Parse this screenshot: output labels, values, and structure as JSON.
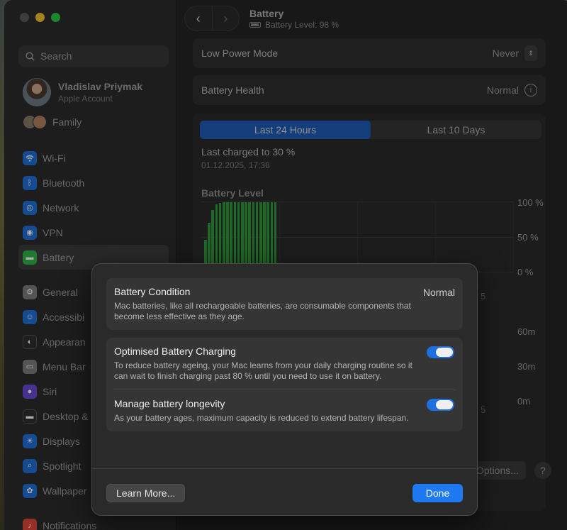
{
  "sidebar": {
    "search_placeholder": "Search",
    "user": {
      "name": "Vladislav Priymak",
      "subtitle": "Apple Account"
    },
    "family_label": "Family",
    "items": [
      {
        "label": "Wi-Fi",
        "icon": "wifi-icon"
      },
      {
        "label": "Bluetooth",
        "icon": "bluetooth-icon"
      },
      {
        "label": "Network",
        "icon": "network-icon"
      },
      {
        "label": "VPN",
        "icon": "vpn-icon"
      },
      {
        "label": "Battery",
        "icon": "battery-icon",
        "selected": true
      },
      {
        "label": "General",
        "icon": "gear-icon"
      },
      {
        "label": "Accessibi",
        "icon": "accessibility-icon"
      },
      {
        "label": "Appearan",
        "icon": "appearance-icon"
      },
      {
        "label": "Menu Bar",
        "icon": "menubar-icon"
      },
      {
        "label": "Siri",
        "icon": "siri-icon"
      },
      {
        "label": "Desktop &",
        "icon": "desktop-icon"
      },
      {
        "label": "Displays",
        "icon": "displays-icon"
      },
      {
        "label": "Spotlight",
        "icon": "spotlight-icon"
      },
      {
        "label": "Wallpaper",
        "icon": "wallpaper-icon"
      },
      {
        "label": "Notifications",
        "icon": "notifications-icon"
      }
    ]
  },
  "header": {
    "title": "Battery",
    "subtitle": "Battery Level: 98 %",
    "back": "‹",
    "forward": "›"
  },
  "settings": {
    "low_power_label": "Low Power Mode",
    "low_power_value": "Never",
    "health_label": "Battery Health",
    "health_value": "Normal"
  },
  "usage": {
    "tabs": [
      "Last 24 Hours",
      "Last 10 Days"
    ],
    "active_tab": 0,
    "last_charged": "Last charged to 30 %",
    "last_charged_date": "01.12.2025, 17:38",
    "chart_title": "Battery Level",
    "y_ticks": [
      "100 %",
      "50 %",
      "0 %"
    ],
    "y_ticks_screen": [
      "60m",
      "30m",
      "0m"
    ],
    "partial_x_tick": "5",
    "options_button": "Options...",
    "help_button": "?"
  },
  "chart_data": {
    "type": "bar",
    "title": "Battery Level",
    "ylabel": "",
    "ylim": [
      0,
      100
    ],
    "yticks": [
      "100 %",
      "50 %",
      "0 %"
    ],
    "values": [
      45,
      70,
      88,
      96,
      98,
      99,
      99,
      99,
      99,
      99,
      99,
      99,
      99,
      99,
      99,
      99,
      99,
      99,
      99,
      99
    ]
  },
  "modal": {
    "condition_title": "Battery Condition",
    "condition_value": "Normal",
    "condition_desc": "Mac batteries, like all rechargeable batteries, are consumable components that become less effective as they age.",
    "optimised_title": "Optimised Battery Charging",
    "optimised_desc": "To reduce battery ageing, your Mac learns from your daily charging routine so it can wait to finish charging past 80 % until you need to use it on battery.",
    "optimised_on": true,
    "longevity_title": "Manage battery longevity",
    "longevity_desc": "As your battery ages, maximum capacity is reduced to extend battery lifespan.",
    "longevity_on": true,
    "learn_more": "Learn More...",
    "done": "Done"
  },
  "colors": {
    "accent": "#1f7af2",
    "chart_bar": "#2f9a3a",
    "tab_active": "#1e5bb5"
  }
}
